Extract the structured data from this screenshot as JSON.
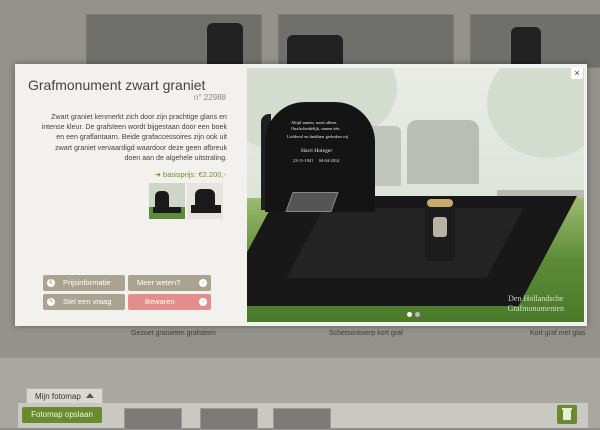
{
  "background": {
    "captions": [
      "Gezoet granieten grafsteen",
      "Schetsontwerp kort graf",
      "Kort graf met glas"
    ]
  },
  "modal": {
    "title": "Grafmonument zwart graniet",
    "ref": "n° 22988",
    "description": "Zwart graniet kenmerkt zich door zijn prachtige glans en intense kleur. De grafsteen wordt bijgestaan door een boek en een graflantaarn. Beide grafaccessoires zijn ook uit zwart graniet vervaardigd waardoor deze geen afbreuk doen aan de algehele uitstraling.",
    "price": "basisprijs: €2.200,-",
    "buttons": {
      "prijsinformatie": "Prijsinformatie",
      "meer_weten": "Meer weten?",
      "stel_vraag": "Stel een vraag",
      "bewaren": "Bewaren"
    },
    "close": "×",
    "photo": {
      "inscription_1": "Altijd samen, nooit alleen.",
      "inscription_2": "Onafscheidelijk, samen één.",
      "inscription_3": "Liefdevol en dankbaar gedenken wij",
      "name": "Harri Holeger",
      "dates": "23-11-1941     04-04-2014",
      "watermark_1": "Den Hollandsche",
      "watermark_2": "Grafmonumenten"
    }
  },
  "fotomap": {
    "tab_label": "Mijn fotomap",
    "save_label": "Fotomap opslaan"
  }
}
